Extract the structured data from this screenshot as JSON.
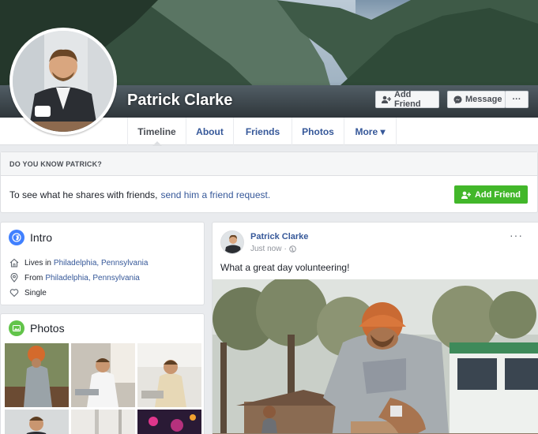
{
  "profile": {
    "name": "Patrick Clarke"
  },
  "cover_actions": {
    "add_friend": "Add Friend",
    "message": "Message",
    "more": "···"
  },
  "tabs": [
    {
      "label": "Timeline",
      "active": true
    },
    {
      "label": "About"
    },
    {
      "label": "Friends"
    },
    {
      "label": "Photos"
    },
    {
      "label": "More ▾"
    }
  ],
  "know": {
    "heading": "DO YOU KNOW PATRICK?",
    "text": "To see what he shares with friends,",
    "link": "send him a friend request.",
    "button": "Add Friend"
  },
  "intro": {
    "title": "Intro",
    "lives_prefix": "Lives in",
    "lives_city": "Philadelphia, Pennsylvania",
    "from_prefix": "From",
    "from_city": "Philadelphia, Pennsylvania",
    "relationship": "Single"
  },
  "photos": {
    "title": "Photos"
  },
  "post": {
    "author": "Patrick Clarke",
    "time": "Just now",
    "separator": "·",
    "text": "What a great day volunteering!",
    "more": "···"
  },
  "icons": {
    "add_friend": "person-plus-icon",
    "message": "messenger-icon",
    "intro": "globe-icon",
    "photos": "photos-icon",
    "home": "house-icon",
    "location": "pin-icon",
    "heart": "heart-icon",
    "privacy": "globe-small-icon"
  },
  "colors": {
    "link": "#365899",
    "green": "#42b72a",
    "intro_icon": "#4080ff",
    "photos_icon": "#62c44a"
  }
}
